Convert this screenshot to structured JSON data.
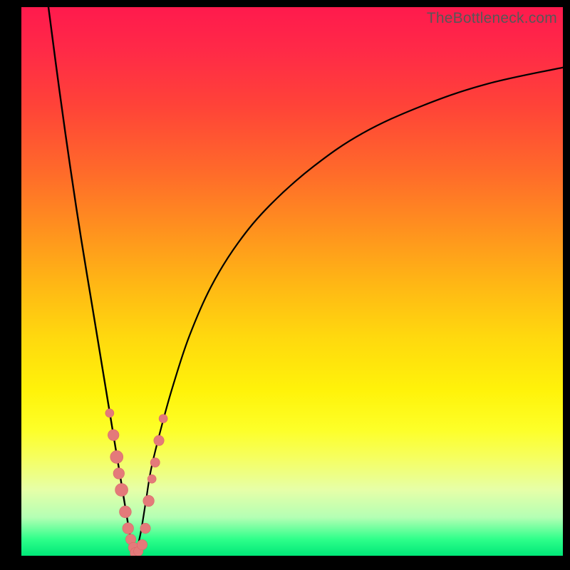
{
  "watermark": "TheBottleneck.com",
  "colors": {
    "frame": "#000000",
    "curve": "#000000",
    "marker_fill": "#e47a7a",
    "marker_stroke": "#d96868"
  },
  "chart_data": {
    "type": "line",
    "title": "",
    "xlabel": "",
    "ylabel": "",
    "xlim": [
      0,
      100
    ],
    "ylim": [
      0,
      100
    ],
    "note": "Bottleneck-style V curve; y = percentage (0 green, 100 red). Values estimated from gradient position.",
    "series": [
      {
        "name": "left-branch",
        "x": [
          5,
          7,
          9,
          11,
          13,
          15,
          16,
          17,
          18,
          19,
          19.5,
          20,
          20.5,
          21
        ],
        "y": [
          100,
          85,
          71,
          58,
          46,
          34,
          28,
          22,
          16,
          10,
          7,
          4,
          2,
          0
        ]
      },
      {
        "name": "right-branch",
        "x": [
          21,
          22,
          23,
          24,
          26,
          28,
          31,
          35,
          40,
          46,
          54,
          63,
          74,
          86,
          100
        ],
        "y": [
          0,
          4,
          10,
          16,
          24,
          31,
          40,
          49,
          57,
          64,
          71,
          77,
          82,
          86,
          89
        ]
      }
    ],
    "markers": {
      "name": "sample-points",
      "comment": "Pink dot clusters near the valley on both branches; y estimated from background hue.",
      "points": [
        {
          "x": 16.3,
          "y": 26,
          "r": 1.0
        },
        {
          "x": 17.0,
          "y": 22,
          "r": 1.3
        },
        {
          "x": 17.6,
          "y": 18,
          "r": 1.5
        },
        {
          "x": 18.0,
          "y": 15,
          "r": 1.3
        },
        {
          "x": 18.5,
          "y": 12,
          "r": 1.5
        },
        {
          "x": 19.2,
          "y": 8,
          "r": 1.4
        },
        {
          "x": 19.7,
          "y": 5,
          "r": 1.3
        },
        {
          "x": 20.2,
          "y": 3,
          "r": 1.2
        },
        {
          "x": 20.7,
          "y": 1.5,
          "r": 1.2
        },
        {
          "x": 21.1,
          "y": 0.5,
          "r": 1.3
        },
        {
          "x": 21.6,
          "y": 0.8,
          "r": 1.1
        },
        {
          "x": 22.3,
          "y": 2,
          "r": 1.2
        },
        {
          "x": 22.9,
          "y": 5,
          "r": 1.2
        },
        {
          "x": 23.5,
          "y": 10,
          "r": 1.3
        },
        {
          "x": 24.1,
          "y": 14,
          "r": 1.0
        },
        {
          "x": 25.4,
          "y": 21,
          "r": 1.2
        },
        {
          "x": 26.2,
          "y": 25,
          "r": 1.0
        },
        {
          "x": 24.7,
          "y": 17,
          "r": 1.1
        }
      ]
    }
  }
}
